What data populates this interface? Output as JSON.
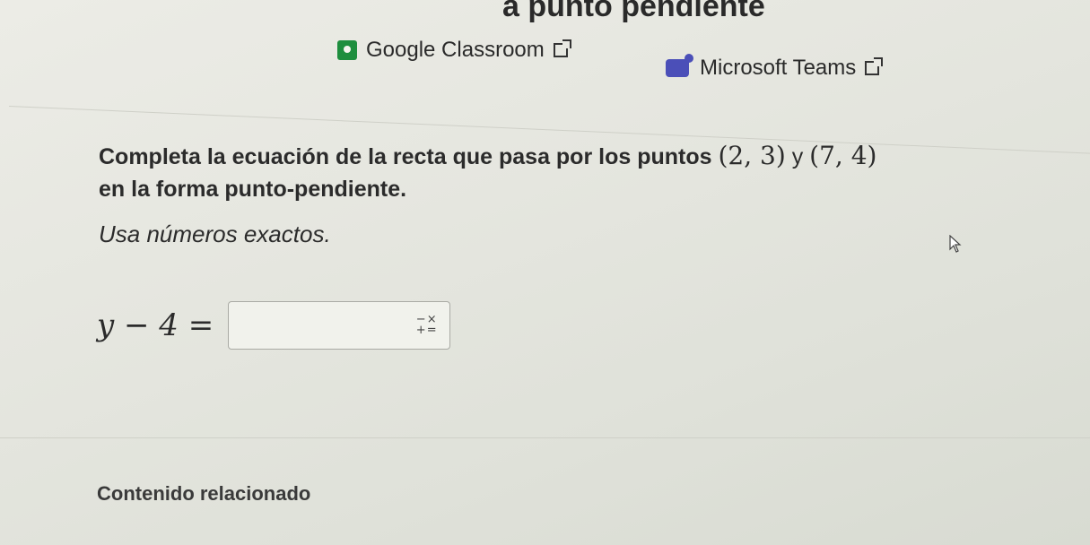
{
  "header": {
    "title": "a punto pendiente"
  },
  "share": {
    "google_classroom": "Google Classroom",
    "microsoft_teams": "Microsoft Teams"
  },
  "question": {
    "text_part1": "Completa la ecuación de la recta que pasa por los puntos ",
    "point1": "(2, 3)",
    "connector": " y ",
    "point2": "(7, 4)",
    "text_part2": "en la forma punto-pendiente.",
    "instruction": "Usa números exactos."
  },
  "equation": {
    "lhs": "y − 4 =",
    "answer_value": "",
    "keypad_symbols": [
      "−",
      "×",
      "+",
      "="
    ]
  },
  "related": {
    "title": "Contenido relacionado"
  },
  "colors": {
    "google_classroom": "#1e8e3e",
    "microsoft_teams": "#4b4fb8"
  }
}
